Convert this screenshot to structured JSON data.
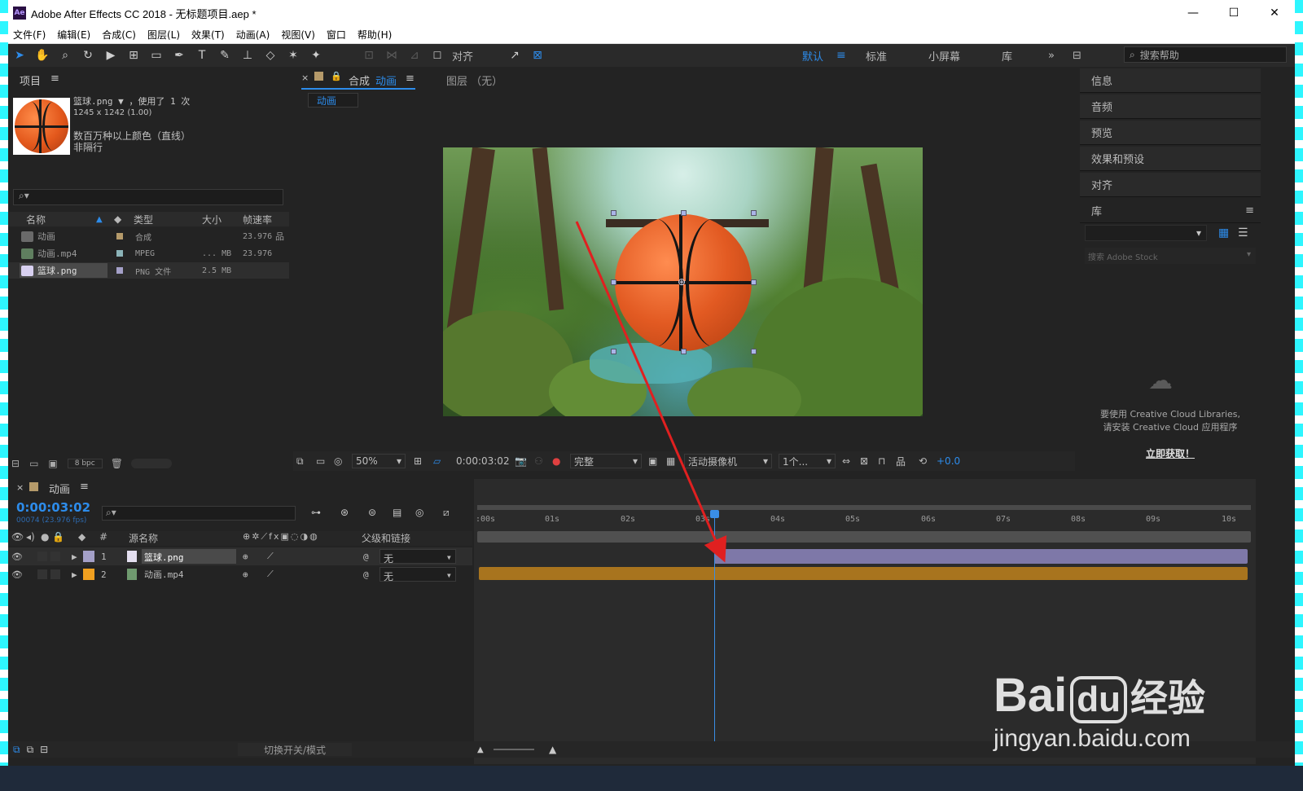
{
  "window": {
    "title": "Adobe After Effects CC 2018 - 无标题项目.aep *",
    "app_icon_text": "Ae",
    "minimize": "—",
    "maximize": "☐",
    "close": "✕"
  },
  "menu": [
    "文件(F)",
    "编辑(E)",
    "合成(C)",
    "图层(L)",
    "效果(T)",
    "动画(A)",
    "视图(V)",
    "窗口",
    "帮助(H)"
  ],
  "toolbar": {
    "align_label": "对齐",
    "workspaces": [
      "默认",
      "标准",
      "小屏幕",
      "库"
    ],
    "active_workspace": "默认",
    "more": "»",
    "help_placeholder": "搜索帮助"
  },
  "project_panel": {
    "tab": "项目",
    "selected_name": "篮球.png",
    "used_text": "，使用了 1 次",
    "dimensions": "1245 x 1242 (1.00)",
    "color_info": "数百万种以上颜色（直线）",
    "interlace": "非隔行",
    "search_placeholder": "",
    "columns": [
      "名称",
      "类型",
      "大小",
      "帧速率"
    ],
    "items": [
      {
        "name": "动画",
        "type": "合成",
        "size": "",
        "fps": "23.976",
        "color": "#b59a6a"
      },
      {
        "name": "动画.mp4",
        "type": "MPEG",
        "size": "... MB",
        "fps": "23.976",
        "color": "#8bb3b8"
      },
      {
        "name": "篮球.png",
        "type": "PNG 文件",
        "size": "2.5 MB",
        "fps": "",
        "color": "#a4a0c8"
      }
    ],
    "bpc": "8 bpc"
  },
  "composition_panel": {
    "tab_prefix": "合成",
    "tab_name": "动画",
    "layer_tab": "图层 （无）",
    "sub_tab": "动画",
    "zoom": "50%",
    "timecode": "0:00:03:02",
    "quality": "完整",
    "camera": "活动摄像机",
    "views": "1个...",
    "exposure": "+0.0"
  },
  "right_panel": {
    "items": [
      "信息",
      "音频",
      "预览",
      "效果和预设",
      "对齐"
    ],
    "library_title": "库",
    "library_search": "搜索 Adobe Stock",
    "cc_message_1": "要使用 Creative Cloud Libraries,",
    "cc_message_2": "请安装 Creative Cloud 应用程序",
    "get_now": "立即获取！"
  },
  "timeline": {
    "tab": "动画",
    "timecode": "0:00:03:02",
    "fps_info": "00074 (23.976 fps)",
    "columns": {
      "num": "#",
      "source": "源名称",
      "parent": "父级和链接"
    },
    "layers": [
      {
        "num": "1",
        "name": "篮球.png",
        "parent": "无",
        "color": "#a4a0c8"
      },
      {
        "num": "2",
        "name": "动画.mp4",
        "parent": "无",
        "color": "#f0a020"
      }
    ],
    "ruler": [
      ":00s",
      "01s",
      "02s",
      "03s",
      "04s",
      "05s",
      "06s",
      "07s",
      "08s",
      "09s",
      "10s"
    ],
    "playhead_seconds": 3.13,
    "toggle_label": "切换开关/模式"
  },
  "watermark": {
    "brand": "Bai",
    "paw": "du",
    "cn": "经验",
    "url": "jingyan.baidu.com"
  },
  "colors": {
    "accent": "#2d8ceb",
    "annotation_arrow": "#e02020",
    "layer1_bar": "#7e78a8",
    "layer2_bar": "#a8741e"
  }
}
